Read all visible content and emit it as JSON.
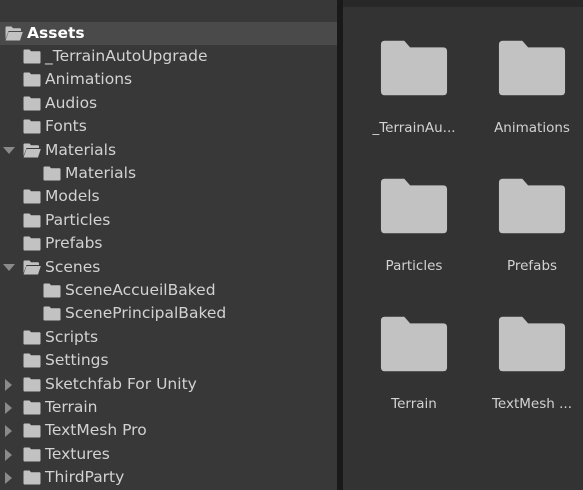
{
  "tree": {
    "items": [
      {
        "label": "Assets",
        "indent": 0,
        "arrow": "",
        "icon": "folder-open",
        "selected": true
      },
      {
        "label": "_TerrainAutoUpgrade",
        "indent": 1,
        "arrow": "",
        "icon": "folder",
        "selected": false
      },
      {
        "label": "Animations",
        "indent": 1,
        "arrow": "",
        "icon": "folder",
        "selected": false
      },
      {
        "label": "Audios",
        "indent": 1,
        "arrow": "",
        "icon": "folder",
        "selected": false
      },
      {
        "label": "Fonts",
        "indent": 1,
        "arrow": "",
        "icon": "folder",
        "selected": false
      },
      {
        "label": "Materials",
        "indent": 1,
        "arrow": "down",
        "icon": "folder-open",
        "selected": false
      },
      {
        "label": "Materials",
        "indent": 2,
        "arrow": "",
        "icon": "folder",
        "selected": false
      },
      {
        "label": "Models",
        "indent": 1,
        "arrow": "",
        "icon": "folder",
        "selected": false
      },
      {
        "label": "Particles",
        "indent": 1,
        "arrow": "",
        "icon": "folder",
        "selected": false
      },
      {
        "label": "Prefabs",
        "indent": 1,
        "arrow": "",
        "icon": "folder",
        "selected": false
      },
      {
        "label": "Scenes",
        "indent": 1,
        "arrow": "down",
        "icon": "folder-open",
        "selected": false
      },
      {
        "label": "SceneAccueilBaked",
        "indent": 2,
        "arrow": "",
        "icon": "folder",
        "selected": false
      },
      {
        "label": "ScenePrincipalBaked",
        "indent": 2,
        "arrow": "",
        "icon": "folder",
        "selected": false
      },
      {
        "label": "Scripts",
        "indent": 1,
        "arrow": "",
        "icon": "folder",
        "selected": false
      },
      {
        "label": "Settings",
        "indent": 1,
        "arrow": "",
        "icon": "folder",
        "selected": false
      },
      {
        "label": "Sketchfab For Unity",
        "indent": 1,
        "arrow": "right",
        "icon": "folder",
        "selected": false
      },
      {
        "label": "Terrain",
        "indent": 1,
        "arrow": "right",
        "icon": "folder",
        "selected": false
      },
      {
        "label": "TextMesh Pro",
        "indent": 1,
        "arrow": "right",
        "icon": "folder",
        "selected": false
      },
      {
        "label": "Textures",
        "indent": 1,
        "arrow": "right",
        "icon": "folder",
        "selected": false
      },
      {
        "label": "ThirdParty",
        "indent": 1,
        "arrow": "right",
        "icon": "folder",
        "selected": false
      }
    ]
  },
  "grid": {
    "tiles": [
      {
        "label": "_TerrainAu..."
      },
      {
        "label": "Animations"
      },
      {
        "label": "Particles"
      },
      {
        "label": "Prefabs"
      },
      {
        "label": "Terrain"
      },
      {
        "label": "TextMesh ..."
      }
    ]
  },
  "colors": {
    "panel": "#383838",
    "selection": "#4a4a4a",
    "folder": "#c2c2c2",
    "text": "#d2d2d2"
  }
}
